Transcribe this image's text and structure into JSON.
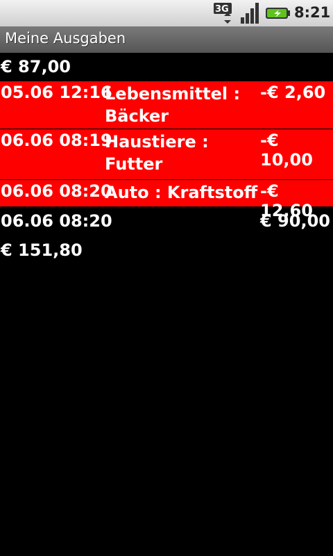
{
  "status_bar": {
    "network_label": "3G",
    "time": "8:21",
    "icons": [
      "3g-data-icon",
      "signal-strength-icon",
      "battery-charging-icon"
    ]
  },
  "app": {
    "title": "Meine Ausgaben"
  },
  "opening_balance": "€ 87,00",
  "transactions": [
    {
      "datetime": "05.06 12:16",
      "category": "Lebensmittel : Bäcker",
      "amount": "-€ 2,60",
      "type": "expense"
    },
    {
      "datetime": "06.06 08:19",
      "category": "Haustiere : Futter",
      "amount": "-€ 10,00",
      "type": "expense"
    },
    {
      "datetime": "06.06 08:20",
      "category": "Auto : Kraftstoff",
      "amount": "-€ 12,60",
      "type": "expense"
    },
    {
      "datetime": "06.06 08:20",
      "category": "",
      "amount": "€ 90,00",
      "type": "income"
    }
  ],
  "total": "€ 151,80",
  "colors": {
    "expense_row": "#ff0000",
    "background": "#000000",
    "text": "#ffffff"
  }
}
